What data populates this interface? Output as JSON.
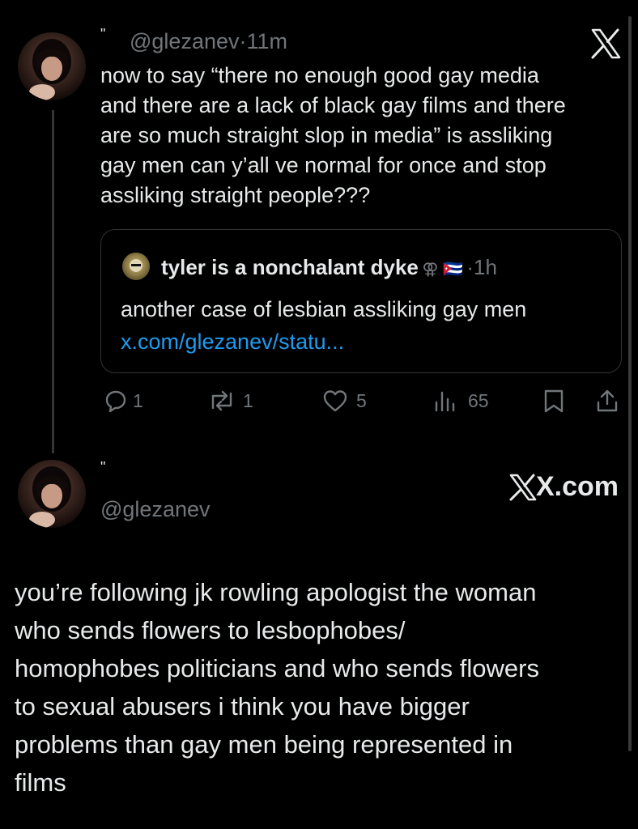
{
  "post": {
    "name_mark": "\"",
    "handle": "@glezanev",
    "dot": "·",
    "time": "11m",
    "text_lines": [
      "now to say “there no enough good gay media",
      "and there are a lack of black gay films and there",
      "are so much straight slop in media” is assliking",
      "gay men can y’all ve normal for once and stop",
      "assliking straight people???"
    ],
    "logo": "X"
  },
  "quote": {
    "name": "tyler is a nonchalant dyke",
    "emoji": "⚢ 🇨🇺",
    "dot": "·",
    "time": "1h",
    "text": "another case of lesbian assliking gay men",
    "link": "x.com/glezanev/statu..."
  },
  "actions": {
    "replies": "1",
    "reposts": "1",
    "likes": "5",
    "views": "65"
  },
  "reply": {
    "name_mark": "\"",
    "handle": "@glezanev",
    "watermark": "X.com",
    "text_lines": [
      "you’re following jk rowling apologist the woman",
      "who sends flowers to lesbophobes/",
      "homophobes politicians and who sends flowers",
      "to sexual abusers i think you have bigger",
      "problems than gay men being represented in",
      "films"
    ]
  },
  "colors": {
    "background": "#000000",
    "text": "#e7e9ea",
    "muted": "#71767b",
    "link": "#1d9bf0"
  }
}
